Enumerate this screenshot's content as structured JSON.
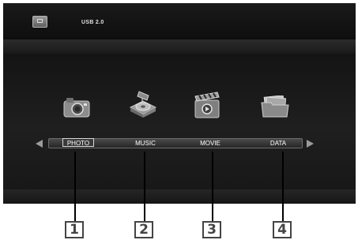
{
  "status_bar": {
    "device_label": "USB 2.0",
    "device_icon": "usb-drive-icon"
  },
  "media_menu": {
    "items": [
      {
        "label": "PHOTO",
        "icon": "camera-icon",
        "selected": true
      },
      {
        "label": "MUSIC",
        "icon": "music-disc-icon",
        "selected": false
      },
      {
        "label": "MOVIE",
        "icon": "clapperboard-icon",
        "selected": false
      },
      {
        "label": "DATA",
        "icon": "folder-icon",
        "selected": false
      }
    ],
    "nav_icons": [
      "arrow-left-icon",
      "arrow-right-icon"
    ]
  },
  "callouts": [
    "1",
    "2",
    "3",
    "4"
  ],
  "colors": {
    "screen_background": "#111111",
    "menu_bar": "#3a3a3a",
    "selected_outline": "#d8d8d8",
    "callout_border": "#444444"
  }
}
